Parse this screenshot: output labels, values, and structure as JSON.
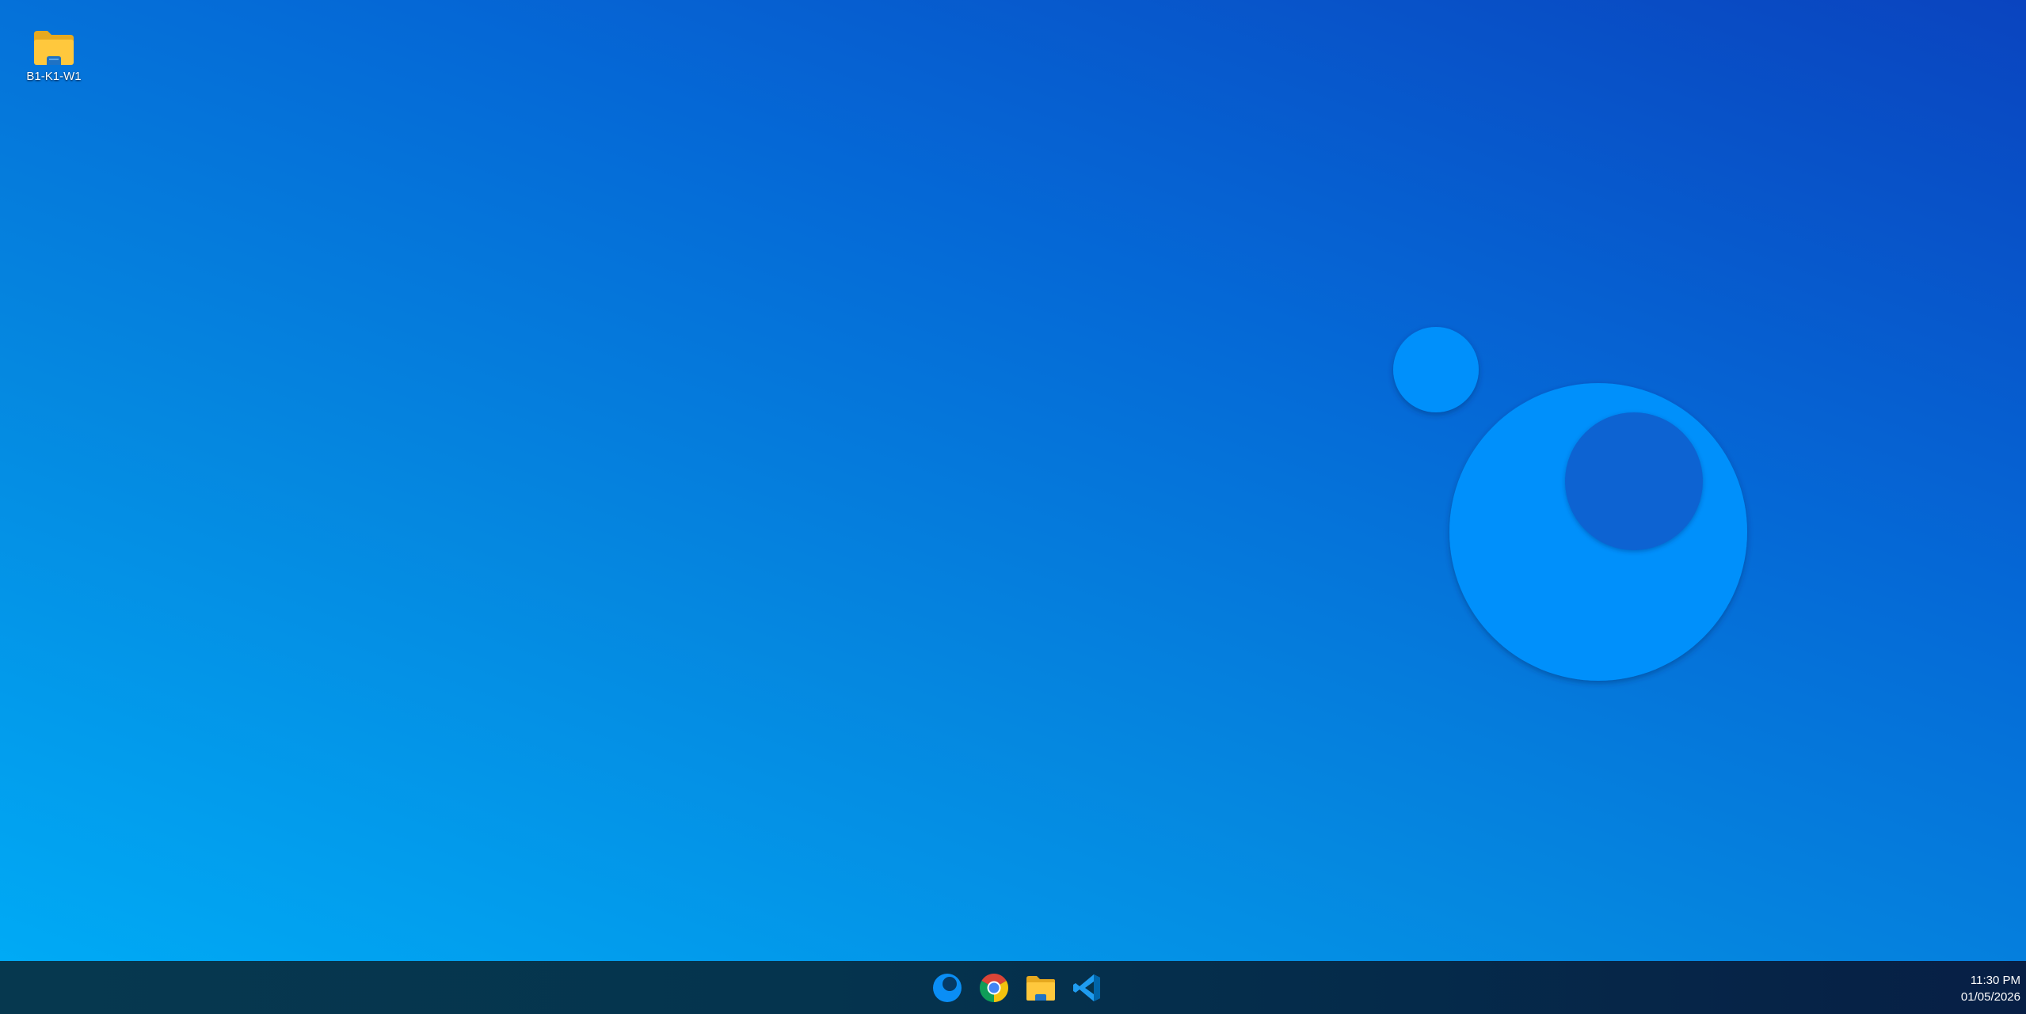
{
  "desktop": {
    "icons": [
      {
        "label": "B1-K1-W1",
        "icon": "folder-icon"
      }
    ]
  },
  "taskbar": {
    "apps": [
      {
        "name": "app-logo",
        "icon": "circle-logo-icon"
      },
      {
        "name": "chrome",
        "icon": "chrome-icon"
      },
      {
        "name": "file-explorer",
        "icon": "folder-icon"
      },
      {
        "name": "vscode",
        "icon": "vscode-icon"
      }
    ],
    "clock": {
      "time": "11:30 PM",
      "date": "01/05/2026"
    }
  },
  "colors": {
    "wallpaper_start": "#00aaf5",
    "wallpaper_end": "#0a44bf",
    "taskbar": "#05344e",
    "logo_blue": "#0090fb"
  }
}
